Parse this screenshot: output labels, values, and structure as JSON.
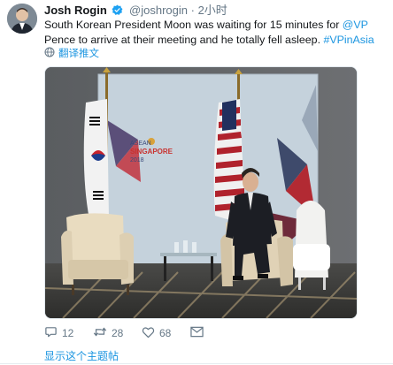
{
  "tweet": {
    "author_name": "Josh Rogin",
    "handle": "@joshrogin",
    "separator": "·",
    "time": "2小时",
    "text_before": "South Korean President Moon was waiting for 15 minutes for ",
    "mention": "@VP",
    "text_middle": " Pence to arrive at their meeting and he totally fell asleep. ",
    "hashtag": "#VPinAsia",
    "translate_label": "翻译推文",
    "replies": "12",
    "retweets": "28",
    "likes": "68",
    "show_thread": "显示这个主题帖"
  },
  "photo": {
    "backdrop_line1": "ASEAN",
    "backdrop_line2": "SINGAPORE",
    "backdrop_line3": "2018"
  },
  "colors": {
    "link": "#1b95e0",
    "muted": "#657786",
    "verified": "#1da1f2"
  },
  "icons": [
    "verified-badge-icon",
    "globe-icon",
    "reply-icon",
    "retweet-icon",
    "like-icon",
    "direct-message-icon"
  ]
}
